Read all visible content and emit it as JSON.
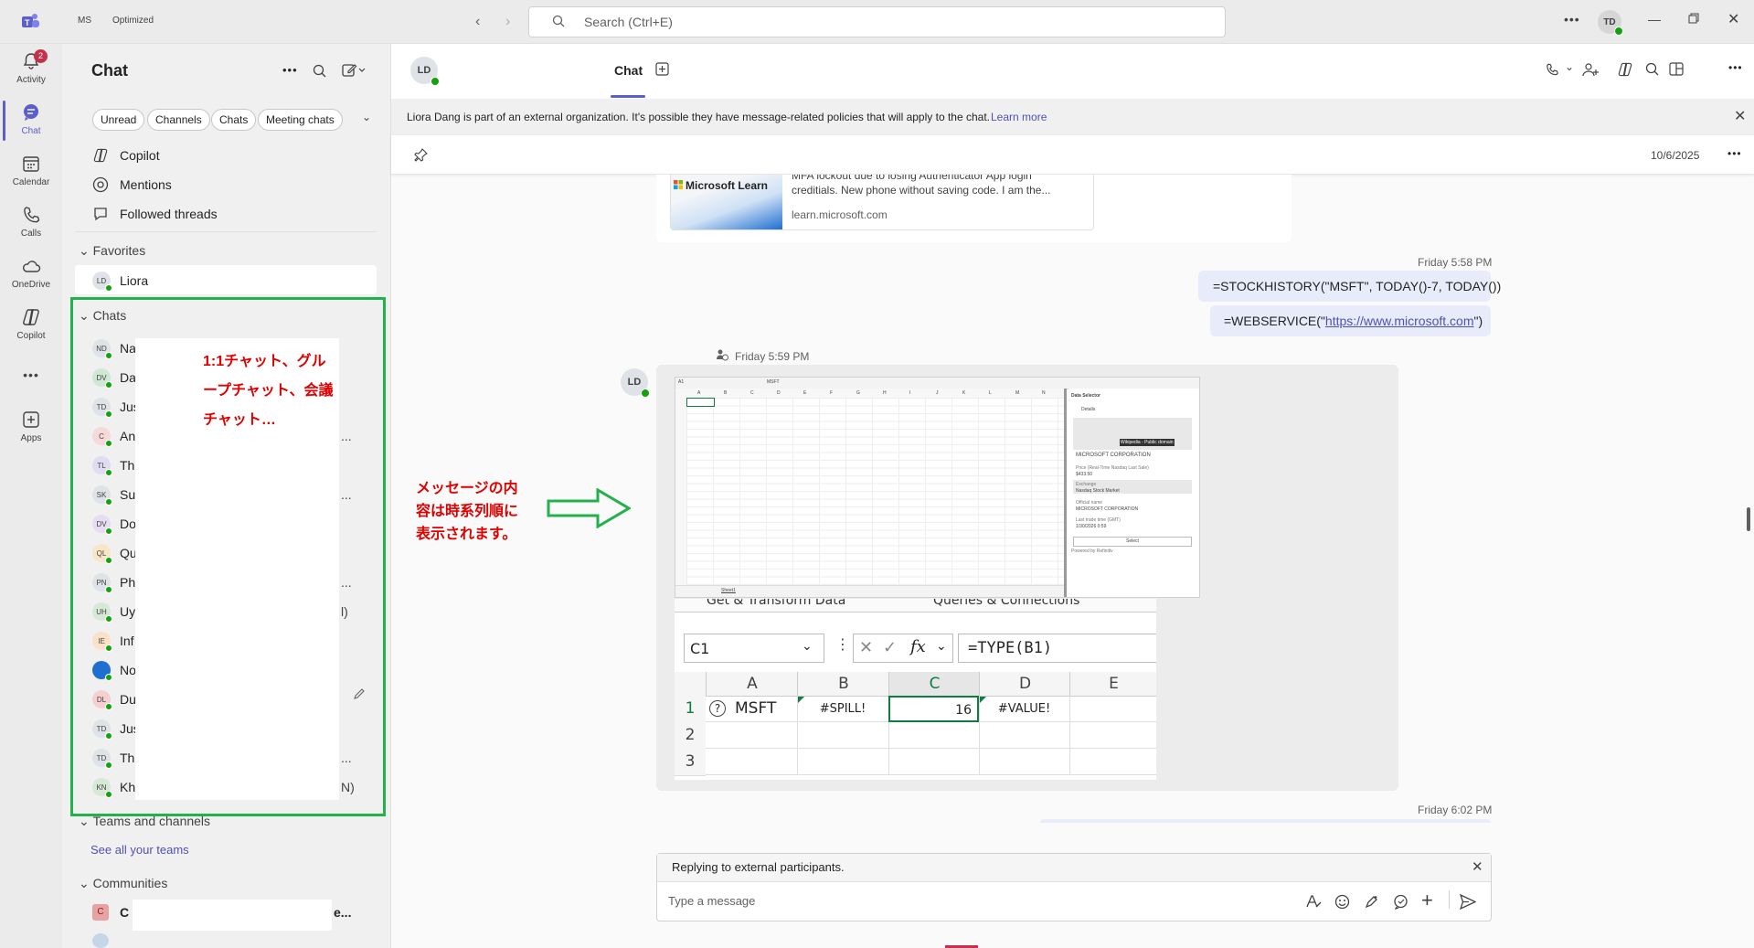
{
  "titlebar": {
    "account_chip": "MS",
    "mode_chip": "Optimized",
    "search_placeholder": "Search (Ctrl+E)",
    "user_initials": "TD"
  },
  "rail": {
    "items": [
      {
        "label": "Activity",
        "badge": "2"
      },
      {
        "label": "Chat"
      },
      {
        "label": "Calendar"
      },
      {
        "label": "Calls"
      },
      {
        "label": "OneDrive"
      },
      {
        "label": "Copilot"
      },
      {
        "label": "Apps"
      }
    ],
    "more_label": "•••"
  },
  "list": {
    "title": "Chat",
    "filters": [
      "Unread",
      "Channels",
      "Chats",
      "Meeting chats"
    ],
    "quick": [
      "Copilot",
      "Mentions",
      "Followed threads"
    ],
    "favorites_label": "Favorites",
    "favorite": {
      "initials": "LD",
      "name": "Liora"
    },
    "chats_label": "Chats",
    "chats": [
      {
        "initials": "ND",
        "name": "Na",
        "suffix": ""
      },
      {
        "initials": "DV",
        "name": "Da",
        "suffix": ""
      },
      {
        "initials": "TD",
        "name": "Jus",
        "suffix": ""
      },
      {
        "initials": "C",
        "name": "An",
        "suffix": "..."
      },
      {
        "initials": "TL",
        "name": "Th",
        "suffix": ""
      },
      {
        "initials": "SK",
        "name": "Su",
        "suffix": "..."
      },
      {
        "initials": "DV",
        "name": "Do",
        "suffix": ""
      },
      {
        "initials": "QL",
        "name": "Qu",
        "suffix": ""
      },
      {
        "initials": "PN",
        "name": "Ph",
        "suffix": "..."
      },
      {
        "initials": "UH",
        "name": "Uy",
        "suffix": "l)"
      },
      {
        "initials": "IE",
        "name": "Inf",
        "suffix": ""
      },
      {
        "initials": "",
        "name": "No",
        "suffix": ""
      },
      {
        "initials": "DL",
        "name": "Du",
        "suffix": ""
      },
      {
        "initials": "TD",
        "name": "Jus",
        "suffix": ""
      },
      {
        "initials": "TD",
        "name": "Th",
        "suffix": "..."
      },
      {
        "initials": "KN",
        "name": "Kh",
        "suffix": "N)"
      }
    ],
    "teams_label": "Teams and channels",
    "see_all_teams": "See all your teams",
    "communities_label": "Communities",
    "community_initial": "C",
    "community_name": "C",
    "community_suffix": "e..."
  },
  "annotations": {
    "chats_note": "1:1チャット、グループチャット、会議チャット…",
    "messages_note": "メッセージの内容は時系列順に表示されます。"
  },
  "chat": {
    "contact_initials": "LD",
    "tab_chat": "Chat",
    "banner_text": "Liora Dang is part of an external organization. It's possible they have message-related policies that will apply to the chat.",
    "banner_link": "Learn more",
    "pin_date": "10/6/2025",
    "link_card": {
      "brand": "Microsoft Learn",
      "text_line1": "MFA lockout due to losing Authenticator App login",
      "text_line2": "creditials. New phone without saving code. I am the...",
      "domain": "learn.microsoft.com"
    },
    "msg1_time": "Friday 5:58 PM",
    "msg1_text": "=STOCKHISTORY(\"MSFT\", TODAY()-7, TODAY())",
    "msg2_prefix": "=WEBSERVICE(\"",
    "msg2_link": "https://www.microsoft.com",
    "msg2_suffix": "\")",
    "msg3_time": "Friday 5:59 PM",
    "msg4_time": "Friday 6:02 PM",
    "excel_small": {
      "cell_ref": "A1",
      "formula": "MSFT",
      "columns": [
        "A",
        "B",
        "C",
        "D",
        "E",
        "F",
        "G",
        "H",
        "I",
        "J",
        "K",
        "L",
        "M",
        "N"
      ],
      "sheet_tab": "Sheet1",
      "pane_title": "Data Selector",
      "pane_details": "Details",
      "pane_wiki": "Wikipedia - Public domain",
      "pane_company": "MICROSOFT CORPORATION",
      "pane_price_label": "Price (Real-Time Nasdaq Last Sale)",
      "pane_price": "$433.50",
      "pane_exchange_label": "Exchange",
      "pane_exchange": "Nasdaq Stock Market",
      "pane_official_label": "Official name",
      "pane_official": "MICROSOFT CORPORATION",
      "pane_lasttrade_label": "Last trade time (GMT)",
      "pane_lasttrade": "1/30/2026 0:59",
      "pane_select": "Select",
      "pane_powered": "Powered by Refinitiv"
    },
    "excel_large": {
      "ribbon_left": "Get & Transform Data",
      "ribbon_right": "Queries & Connections",
      "cell_ref": "C1",
      "fx": "fx",
      "formula": "=TYPE(B1)",
      "columns": [
        "A",
        "B",
        "C",
        "D",
        "E"
      ],
      "rows": [
        "1",
        "2",
        "3"
      ],
      "a1": "MSFT",
      "b1": "#SPILL!",
      "c1": "16",
      "d1": "#VALUE!"
    },
    "compose": {
      "reply_notice": "Replying to external participants.",
      "placeholder": "Type a message"
    }
  },
  "colors": {
    "accent": "#5b5fc7",
    "annotation_red": "#e00000",
    "annotation_green": "#22b14c",
    "presence": "#13a10e"
  }
}
